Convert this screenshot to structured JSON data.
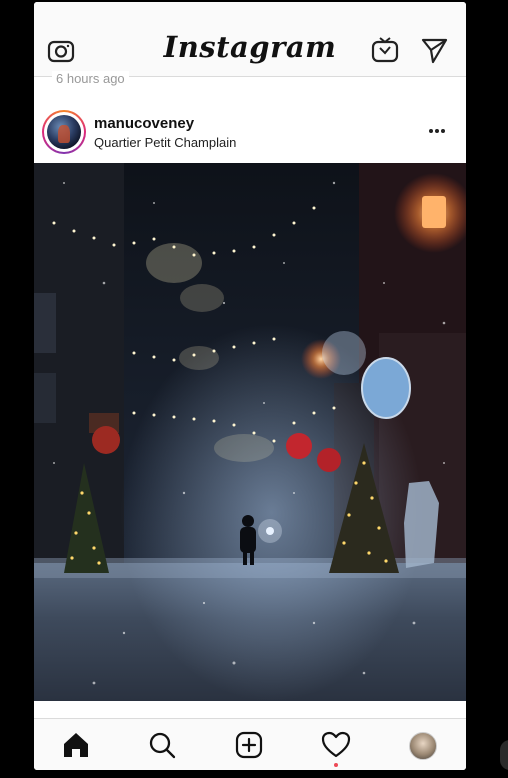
{
  "header": {
    "logo": "Instagram",
    "icons": [
      "camera-icon",
      "igtv-icon",
      "direct-message-icon"
    ]
  },
  "feed": {
    "previous_post_time": "6 hours ago"
  },
  "post": {
    "username": "manucoveney",
    "location": "Quartier Petit Champlain",
    "image_description": "Snowy night street with holiday lights"
  },
  "nav": {
    "items": [
      "home-icon",
      "search-icon",
      "new-post-icon",
      "activity-icon",
      "profile-icon"
    ],
    "activity_indicator_color": "#ed4956"
  },
  "colors": {
    "header_bg": "#fafafa",
    "divider": "#dbdbdb",
    "text": "#111111",
    "story_ring": [
      "#f58529",
      "#dd2a7b",
      "#8134af"
    ]
  }
}
